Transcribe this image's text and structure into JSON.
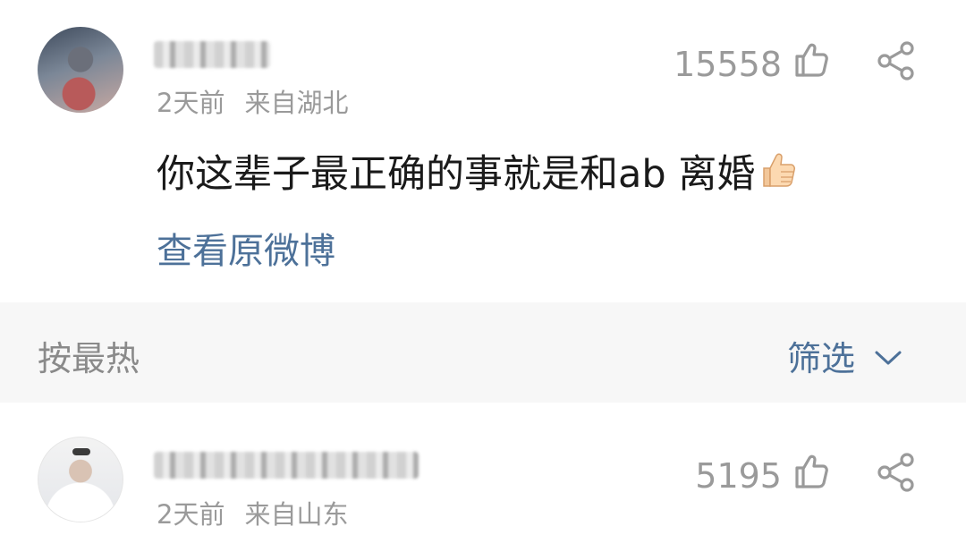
{
  "comments": [
    {
      "time": "2天前",
      "location": "来自湖北",
      "like_count": "15558",
      "text": "你这辈子最正确的事就是和ab 离婚",
      "text_emoji": "thumbs-up-emoji",
      "view_original": "查看原微博"
    },
    {
      "time": "2天前",
      "location": "来自山东",
      "like_count": "5195"
    }
  ],
  "sort_bar": {
    "sort_label": "按最热",
    "filter_label": "筛选"
  },
  "icons": {
    "like": "thumbs-up-outline-icon",
    "share": "share-icon",
    "chevron": "chevron-down-icon"
  },
  "colors": {
    "link_blue": "#4d7199",
    "meta_gray": "#9a9a9a",
    "sort_bar_bg": "#f7f7f7"
  }
}
